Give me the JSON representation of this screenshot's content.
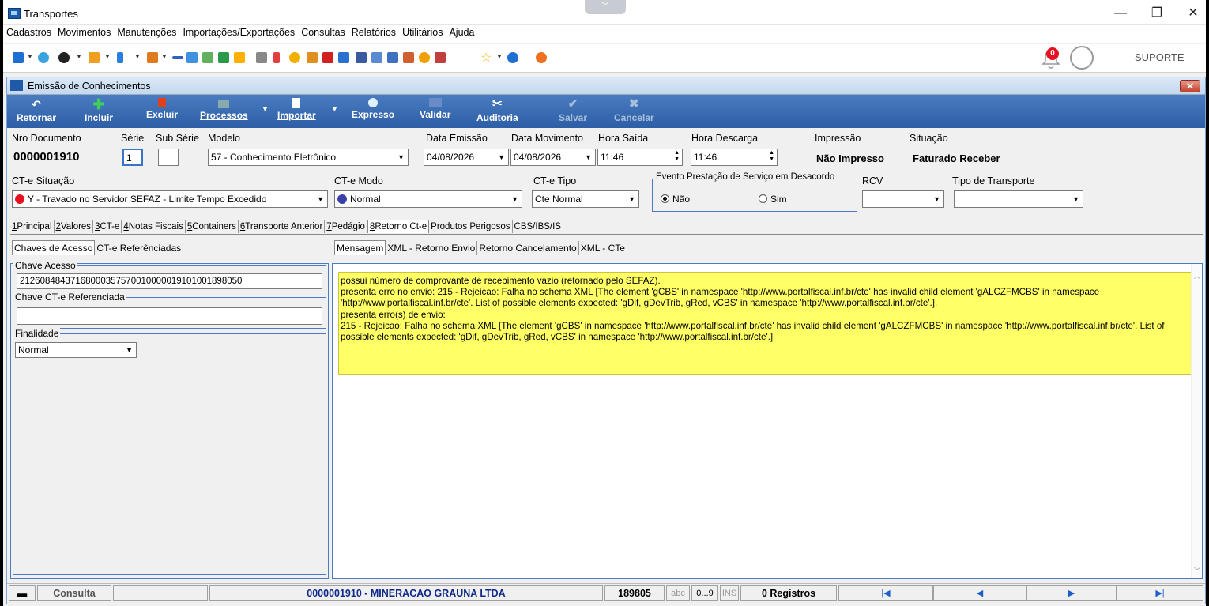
{
  "window": {
    "title": "Transportes",
    "minimize": "—",
    "restore": "❐",
    "close": "✕"
  },
  "menu": [
    "Cadastros",
    "Movimentos",
    "Manutenções",
    "Importações/Exportações",
    "Consultas",
    "Relatórios",
    "Utilitários",
    "Ajuda"
  ],
  "toolbar_right": {
    "notification_count": "0",
    "user_label": "SUPORTE"
  },
  "child_window": {
    "title": "Emissão de Conhecimentos",
    "close": "✕"
  },
  "actions": {
    "retornar": "Retornar",
    "incluir": "Incluir",
    "excluir": "Excluir",
    "processos": "Processos",
    "importar": "Importar",
    "expresso": "Expresso",
    "validar": "Validar",
    "auditoria": "Auditoria",
    "salvar": "Salvar",
    "cancelar": "Cancelar"
  },
  "form": {
    "nro_documento_label": "Nro Documento",
    "nro_documento": "0000001910",
    "serie_label": "Série",
    "serie": "1",
    "sub_serie_label": "Sub Série",
    "sub_serie": "",
    "modelo_label": "Modelo",
    "modelo": "57 - Conhecimento Eletrônico",
    "data_emissao_label": "Data Emissão",
    "data_emissao": "04/08/2026",
    "data_movimento_label": "Data Movimento",
    "data_movimento": "04/08/2026",
    "hora_saida_label": "Hora Saída",
    "hora_saida": "11:46",
    "hora_descarga_label": "Hora Descarga",
    "hora_descarga": "11:46",
    "impressao_label": "Impressão",
    "impressao": "Não Impresso",
    "situacao_label": "Situação",
    "situacao": "Faturado Receber",
    "cte_situacao_label": "CT-e Situação",
    "cte_situacao": "Y - Travado no Servidor SEFAZ -  Limite Tempo Excedido",
    "cte_modo_label": "CT-e Modo",
    "cte_modo": "Normal",
    "cte_tipo_label": "CT-e Tipo",
    "cte_tipo": "Cte Normal",
    "evento_label": "Evento Prestação de Serviço em Desacordo",
    "evento_nao": "Não",
    "evento_sim": "Sim",
    "rcv_label": "RCV",
    "rcv": "",
    "tipo_transporte_label": "Tipo de Transporte",
    "tipo_transporte": "",
    "cte_situacao_color": "#e81123",
    "cte_modo_color": "#3b3fa8"
  },
  "main_tabs": [
    {
      "key": "1",
      "label": " Principal"
    },
    {
      "key": "2",
      "label": " Valores"
    },
    {
      "key": "3",
      "label": " CT-e"
    },
    {
      "key": "4",
      "label": " Notas Fiscais"
    },
    {
      "key": "5",
      "label": " Containers"
    },
    {
      "key": "6",
      "label": " Transporte Anterior"
    },
    {
      "key": "7",
      "label": " Pedágio"
    },
    {
      "key": "8",
      "label": " Retorno Ct-e"
    },
    {
      "key": "",
      "label": "Produtos Perigosos"
    },
    {
      "key": "",
      "label": "CBS/IBS/IS"
    }
  ],
  "left_tabs": [
    "Chaves de Acesso",
    "CT-e Referênciadas"
  ],
  "right_tabs": [
    "Mensagem",
    "XML - Retorno Envio",
    "Retorno Cancelamento",
    "XML - CTe"
  ],
  "left_panel": {
    "chave_acesso_label": "Chave Acesso",
    "chave_acesso": "21260848437168000357570010000019101001898050",
    "chave_ref_label": "Chave CT-e Referenciada",
    "chave_ref": "",
    "finalidade_label": "Finalidade",
    "finalidade": "Normal"
  },
  "message_lines": [
    "possui número de comprovante de recebimento vazio (retornado pelo SEFAZ).",
    "presenta erro no envio: 215 - Rejeicao: Falha no schema XML [The element 'gCBS' in namespace 'http://www.portalfiscal.inf.br/cte' has invalid child element 'gALCZFMCBS' in namespace",
    "'http://www.portalfiscal.inf.br/cte'. List of possible elements expected: 'gDif, gDevTrib, gRed, vCBS' in namespace 'http://www.portalfiscal.inf.br/cte'.].",
    "presenta erro(s) de envio:",
    "215 - Rejeicao: Falha no schema XML [The element 'gCBS' in namespace 'http://www.portalfiscal.inf.br/cte' has invalid child element 'gALCZFMCBS' in namespace 'http://www.portalfiscal.inf.br/cte'. List of",
    "possible elements expected: 'gDif, gDevTrib, gRed, vCBS' in namespace 'http://www.portalfiscal.inf.br/cte'.]"
  ],
  "status": {
    "mode": "Consulta",
    "record": "0000001910 - MINERACAO GRAUNA LTDA",
    "code": "189805",
    "abc": "abc",
    "num": "0...9",
    "ins": "INS",
    "registros": "0 Registros",
    "first": "|◀",
    "prev": "◀",
    "next": "▶",
    "last": "▶|"
  }
}
